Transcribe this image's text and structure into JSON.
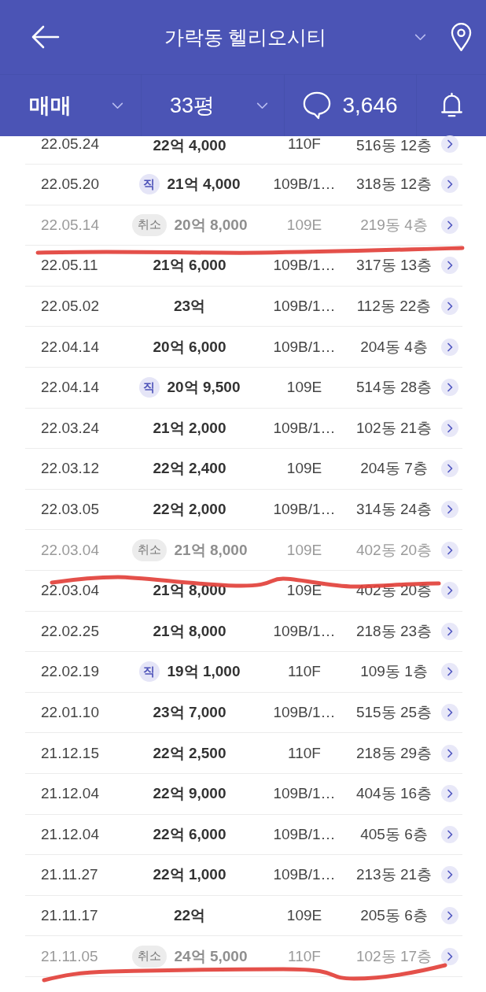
{
  "header": {
    "title": "가락동 헬리오시티"
  },
  "filter_bar": {
    "deal_type": "매매",
    "size": "33평",
    "comment_count": "3,646"
  },
  "rows": [
    {
      "date": "22.05.24",
      "price": "22억 4,000",
      "area": "110F",
      "unit": "516동 12층",
      "cancelled": false,
      "marked": false
    },
    {
      "date": "22.05.20",
      "badge": {
        "kind": "direct",
        "label": "직"
      },
      "price": "21억 4,000",
      "area": "109B/1…",
      "unit": "318동 12층",
      "cancelled": false,
      "marked": false
    },
    {
      "date": "22.05.14",
      "badge": {
        "kind": "cancel",
        "label": "취소"
      },
      "price": "20억 8,000",
      "area": "109E",
      "unit": "219동 4층",
      "cancelled": true,
      "marked": true
    },
    {
      "date": "22.05.11",
      "price": "21억 6,000",
      "area": "109B/1…",
      "unit": "317동 13층",
      "cancelled": false,
      "marked": false
    },
    {
      "date": "22.05.02",
      "price": "23억",
      "area": "109B/1…",
      "unit": "112동 22층",
      "cancelled": false,
      "marked": false
    },
    {
      "date": "22.04.14",
      "price": "20억 6,000",
      "area": "109B/1…",
      "unit": "204동 4층",
      "cancelled": false,
      "marked": false
    },
    {
      "date": "22.04.14",
      "badge": {
        "kind": "direct",
        "label": "직"
      },
      "price": "20억 9,500",
      "area": "109E",
      "unit": "514동 28층",
      "cancelled": false,
      "marked": false
    },
    {
      "date": "22.03.24",
      "price": "21억 2,000",
      "area": "109B/1…",
      "unit": "102동 21층",
      "cancelled": false,
      "marked": false
    },
    {
      "date": "22.03.12",
      "price": "22억 2,400",
      "area": "109E",
      "unit": "204동 7층",
      "cancelled": false,
      "marked": false
    },
    {
      "date": "22.03.05",
      "price": "22억 2,000",
      "area": "109B/1…",
      "unit": "314동 24층",
      "cancelled": false,
      "marked": false
    },
    {
      "date": "22.03.04",
      "badge": {
        "kind": "cancel",
        "label": "취소"
      },
      "price": "21억 8,000",
      "area": "109E",
      "unit": "402동 20층",
      "cancelled": true,
      "marked": true
    },
    {
      "date": "22.03.04",
      "price": "21억 8,000",
      "area": "109E",
      "unit": "402동 20층",
      "cancelled": false,
      "marked": false
    },
    {
      "date": "22.02.25",
      "price": "21억 8,000",
      "area": "109B/1…",
      "unit": "218동 23층",
      "cancelled": false,
      "marked": false
    },
    {
      "date": "22.02.19",
      "badge": {
        "kind": "direct",
        "label": "직"
      },
      "price": "19억 1,000",
      "area": "110F",
      "unit": "109동 1층",
      "cancelled": false,
      "marked": false
    },
    {
      "date": "22.01.10",
      "price": "23억 7,000",
      "area": "109B/1…",
      "unit": "515동 25층",
      "cancelled": false,
      "marked": false
    },
    {
      "date": "21.12.15",
      "price": "22억 2,500",
      "area": "110F",
      "unit": "218동 29층",
      "cancelled": false,
      "marked": false
    },
    {
      "date": "21.12.04",
      "price": "22억 9,000",
      "area": "109B/1…",
      "unit": "404동 16층",
      "cancelled": false,
      "marked": false
    },
    {
      "date": "21.12.04",
      "price": "22억 6,000",
      "area": "109B/1…",
      "unit": "405동 6층",
      "cancelled": false,
      "marked": false
    },
    {
      "date": "21.11.27",
      "price": "22억 1,000",
      "area": "109B/1…",
      "unit": "213동 21층",
      "cancelled": false,
      "marked": false
    },
    {
      "date": "21.11.17",
      "price": "22억",
      "area": "109E",
      "unit": "205동 6층",
      "cancelled": false,
      "marked": false
    },
    {
      "date": "21.11.05",
      "badge": {
        "kind": "cancel",
        "label": "취소"
      },
      "price": "24억 5,000",
      "area": "110F",
      "unit": "102동 17층",
      "cancelled": true,
      "marked": true
    }
  ]
}
